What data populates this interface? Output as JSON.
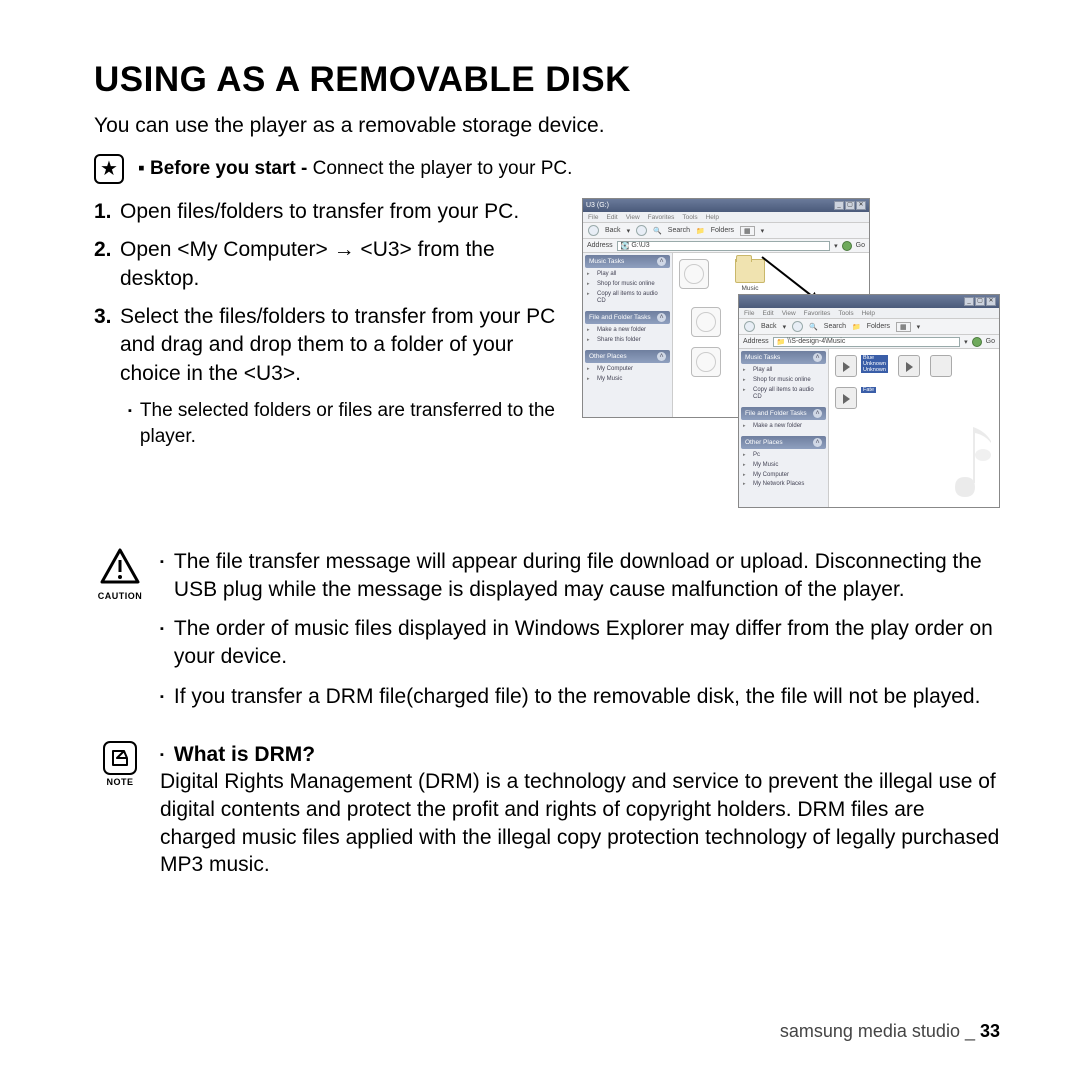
{
  "title": "USING AS A REMOVABLE DISK",
  "intro": "You can use the player as a removable storage device.",
  "before": {
    "bold": "Before you start - ",
    "rest": "Connect the player to your PC."
  },
  "steps": [
    "Open files/folders to transfer from your PC.",
    "Open <My Computer> → <U3> from the desktop.",
    "Select the files/folders to transfer from your PC and drag and drop them to a folder of your choice in the <U3>."
  ],
  "step_sub": "The selected folders or files are transferred to the player.",
  "figure": {
    "win_a": {
      "title": "U3 (G:)",
      "menu": [
        "File",
        "Edit",
        "View",
        "Favorites",
        "Tools",
        "Help"
      ],
      "toolbar": {
        "back": "Back",
        "search": "Search",
        "folders": "Folders"
      },
      "address_label": "Address",
      "address": "G:\\U3",
      "go": "Go",
      "side": {
        "music_tasks": "Music Tasks",
        "music_items": [
          "Play all",
          "Shop for music online",
          "Copy all items to audio CD"
        ],
        "file_tasks": "File and Folder Tasks",
        "file_items": [
          "Make a new folder",
          "Share this folder"
        ],
        "other": "Other Places",
        "other_items": [
          "My Computer",
          "My Music"
        ]
      },
      "content_label": "Music"
    },
    "win_b": {
      "menu": [
        "File",
        "Edit",
        "View",
        "Favorites",
        "Tools",
        "Help"
      ],
      "toolbar": {
        "back": "Back",
        "search": "Search",
        "folders": "Folders"
      },
      "address_label": "Address",
      "address": "\\\\S-design-4\\Music",
      "go": "Go",
      "side": {
        "music_tasks": "Music Tasks",
        "music_items": [
          "Play all",
          "Shop for music online",
          "Copy all items to audio CD"
        ],
        "file_tasks": "File and Folder Tasks",
        "file_items": [
          "Make a new folder"
        ],
        "other": "Other Places",
        "other_items": [
          "Pc",
          "My Music",
          "My Computer",
          "My Network Places"
        ]
      },
      "sel1": "Blue\nUnknown\nUnknown",
      "sel2": "Fate"
    }
  },
  "caution": {
    "label": "CAUTION",
    "items": [
      "The file transfer message will appear during file download or upload. Disconnecting the USB plug while the message is displayed may cause malfunction of the player.",
      "The order of music files displayed in Windows Explorer may differ from the play order on your device.",
      "If you transfer a DRM file(charged file) to the removable disk, the file will not be played."
    ]
  },
  "note": {
    "label": "NOTE",
    "heading": "What is DRM?",
    "body": "Digital Rights Management (DRM) is a technology and service to prevent the illegal use of digital contents and protect the profit and rights of copyright holders. DRM files are charged music files applied with the illegal copy protection technology of legally purchased MP3 music."
  },
  "footer": {
    "section": "samsung media studio _ ",
    "page": "33"
  }
}
